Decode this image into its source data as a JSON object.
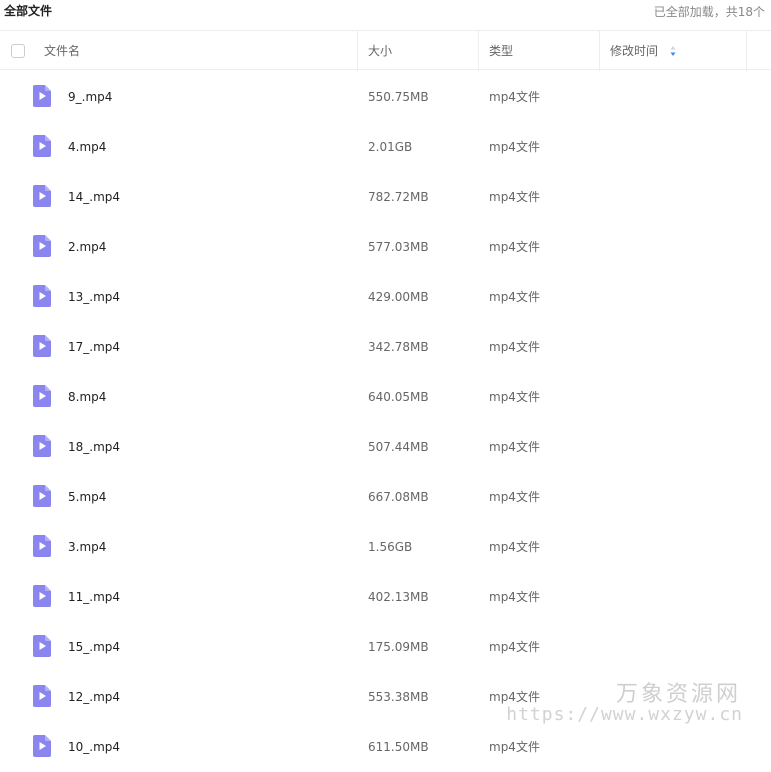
{
  "top": {
    "title": "全部文件",
    "status": "已全部加载，共18个"
  },
  "header": {
    "name": "文件名",
    "size": "大小",
    "type": "类型",
    "mtime": "修改时间"
  },
  "files": [
    {
      "name": "9_.mp4",
      "size": "550.75MB",
      "type": "mp4文件"
    },
    {
      "name": "4.mp4",
      "size": "2.01GB",
      "type": "mp4文件"
    },
    {
      "name": "14_.mp4",
      "size": "782.72MB",
      "type": "mp4文件"
    },
    {
      "name": "2.mp4",
      "size": "577.03MB",
      "type": "mp4文件"
    },
    {
      "name": "13_.mp4",
      "size": "429.00MB",
      "type": "mp4文件"
    },
    {
      "name": "17_.mp4",
      "size": "342.78MB",
      "type": "mp4文件"
    },
    {
      "name": "8.mp4",
      "size": "640.05MB",
      "type": "mp4文件"
    },
    {
      "name": "18_.mp4",
      "size": "507.44MB",
      "type": "mp4文件"
    },
    {
      "name": "5.mp4",
      "size": "667.08MB",
      "type": "mp4文件"
    },
    {
      "name": "3.mp4",
      "size": "1.56GB",
      "type": "mp4文件"
    },
    {
      "name": "11_.mp4",
      "size": "402.13MB",
      "type": "mp4文件"
    },
    {
      "name": "15_.mp4",
      "size": "175.09MB",
      "type": "mp4文件"
    },
    {
      "name": "12_.mp4",
      "size": "553.38MB",
      "type": "mp4文件"
    },
    {
      "name": "10_.mp4",
      "size": "611.50MB",
      "type": "mp4文件"
    }
  ],
  "watermark": {
    "line1": "万象资源网",
    "line2": "https://www.wxzyw.cn"
  },
  "colors": {
    "video_icon": "#8b85f0",
    "sort_icon": "#3a8ee6"
  },
  "icons": {
    "file": "video-file-icon",
    "sort": "sort-arrow-icon"
  }
}
